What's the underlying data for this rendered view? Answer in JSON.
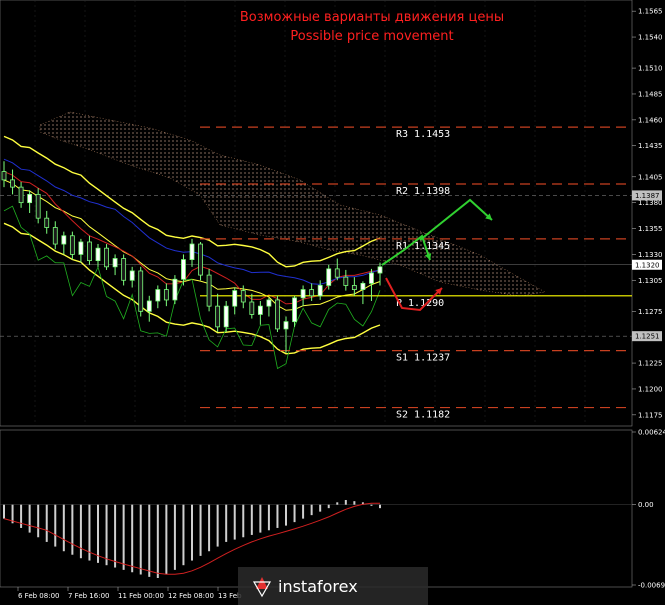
{
  "chart_data": {
    "type": "candlestick",
    "title_ru": "Возможные варианты движения цены",
    "title_en": "Possible price movement",
    "price_axis": {
      "ylim": [
        1.117,
        1.157
      ],
      "ticks": [
        "1.1565",
        "1.1540",
        "1.1510",
        "1.1485",
        "1.1460",
        "1.1435",
        "1.1405",
        "1.1380",
        "1.1355",
        "1.1330",
        "1.1305",
        "1.1275",
        "1.1250",
        "1.1225",
        "1.1200",
        "1.1175"
      ],
      "highlights": [
        {
          "label": "1.1387",
          "value": 1.1387,
          "color": "#c0c0c0"
        },
        {
          "label": "1.1320",
          "value": 1.132,
          "color": "#ffffff"
        },
        {
          "label": "1.1251",
          "value": 1.1251,
          "color": "#c0c0c0"
        }
      ]
    },
    "levels": [
      {
        "name": "R3",
        "value": 1.1453,
        "label": "1.1453",
        "color": "#c84020"
      },
      {
        "name": "R2",
        "value": 1.1398,
        "label": "1.1398",
        "color": "#c84020"
      },
      {
        "name": "R1",
        "value": 1.1345,
        "label": "1.1345",
        "color": "#c84020"
      },
      {
        "name": "P",
        "value": 1.129,
        "label": "1.1290",
        "color": "#ffff00"
      },
      {
        "name": "S1",
        "value": 1.1237,
        "label": "1.1237",
        "color": "#c84020"
      },
      {
        "name": "S2",
        "value": 1.1182,
        "label": "1.1182",
        "color": "#c84020"
      }
    ],
    "time_axis": [
      "6 Feb 08:00",
      "7 Feb 16:00",
      "11 Feb 00:00",
      "12 Feb 08:00",
      "13 Feb"
    ],
    "candles": [
      [
        1.141,
        1.142,
        1.1395,
        1.1402
      ],
      [
        1.1402,
        1.1412,
        1.1388,
        1.1395
      ],
      [
        1.1395,
        1.14,
        1.1375,
        1.138
      ],
      [
        1.138,
        1.1392,
        1.137,
        1.1388
      ],
      [
        1.1388,
        1.1394,
        1.136,
        1.1365
      ],
      [
        1.1365,
        1.1372,
        1.135,
        1.1356
      ],
      [
        1.1356,
        1.1362,
        1.1335,
        1.134
      ],
      [
        1.134,
        1.1352,
        1.133,
        1.1348
      ],
      [
        1.1348,
        1.1352,
        1.1325,
        1.133
      ],
      [
        1.133,
        1.1345,
        1.1322,
        1.1342
      ],
      [
        1.1342,
        1.1348,
        1.132,
        1.1324
      ],
      [
        1.1324,
        1.134,
        1.1318,
        1.1336
      ],
      [
        1.1336,
        1.134,
        1.1315,
        1.1318
      ],
      [
        1.1318,
        1.133,
        1.131,
        1.1326
      ],
      [
        1.1326,
        1.133,
        1.13,
        1.1305
      ],
      [
        1.1305,
        1.1318,
        1.1298,
        1.1314
      ],
      [
        1.1314,
        1.1318,
        1.127,
        1.1275
      ],
      [
        1.1275,
        1.129,
        1.1265,
        1.1285
      ],
      [
        1.1285,
        1.13,
        1.1278,
        1.1296
      ],
      [
        1.1296,
        1.1302,
        1.128,
        1.1286
      ],
      [
        1.1286,
        1.131,
        1.1282,
        1.1306
      ],
      [
        1.1306,
        1.133,
        1.13,
        1.1325
      ],
      [
        1.1325,
        1.1345,
        1.1318,
        1.134
      ],
      [
        1.134,
        1.1342,
        1.1305,
        1.131
      ],
      [
        1.131,
        1.1316,
        1.1275,
        1.128
      ],
      [
        1.128,
        1.1292,
        1.1255,
        1.126
      ],
      [
        1.126,
        1.1285,
        1.1255,
        1.128
      ],
      [
        1.128,
        1.1298,
        1.1272,
        1.1295
      ],
      [
        1.1295,
        1.13,
        1.1278,
        1.1284
      ],
      [
        1.1284,
        1.1292,
        1.1268,
        1.1272
      ],
      [
        1.1272,
        1.1285,
        1.1262,
        1.128
      ],
      [
        1.128,
        1.1288,
        1.127,
        1.1286
      ],
      [
        1.1286,
        1.129,
        1.1255,
        1.1258
      ],
      [
        1.1258,
        1.127,
        1.1235,
        1.1265
      ],
      [
        1.1265,
        1.129,
        1.126,
        1.1288
      ],
      [
        1.1288,
        1.13,
        1.128,
        1.1296
      ],
      [
        1.1296,
        1.1302,
        1.1285,
        1.129
      ],
      [
        1.129,
        1.1305,
        1.1286,
        1.13
      ],
      [
        1.13,
        1.132,
        1.1296,
        1.1316
      ],
      [
        1.1316,
        1.1326,
        1.1305,
        1.1308
      ],
      [
        1.1308,
        1.1315,
        1.1295,
        1.13
      ],
      [
        1.13,
        1.1308,
        1.129,
        1.1296
      ],
      [
        1.1296,
        1.1304,
        1.1282,
        1.1302
      ],
      [
        1.1302,
        1.1316,
        1.1285,
        1.1312
      ],
      [
        1.1312,
        1.1322,
        1.13,
        1.1318
      ]
    ],
    "macd_axis": {
      "ticks": [
        "0.00624",
        "0.00",
        "-0.0069"
      ],
      "ylim": [
        -0.0069,
        0.00624
      ]
    },
    "macd_histogram": [
      -0.0012,
      -0.0016,
      -0.002,
      -0.0024,
      -0.0028,
      -0.0032,
      -0.0036,
      -0.004,
      -0.0043,
      -0.0046,
      -0.0048,
      -0.005,
      -0.0052,
      -0.0054,
      -0.0056,
      -0.0058,
      -0.006,
      -0.0062,
      -0.0063,
      -0.006,
      -0.0056,
      -0.0052,
      -0.0048,
      -0.0044,
      -0.004,
      -0.0036,
      -0.0032,
      -0.003,
      -0.0028,
      -0.0026,
      -0.0024,
      -0.0022,
      -0.002,
      -0.0018,
      -0.0015,
      -0.0012,
      -0.0009,
      -0.0006,
      -0.0003,
      0.0002,
      0.0004,
      0.0003,
      0.0002,
      -0.0001,
      -0.0003
    ],
    "watermark": "instaforex"
  }
}
